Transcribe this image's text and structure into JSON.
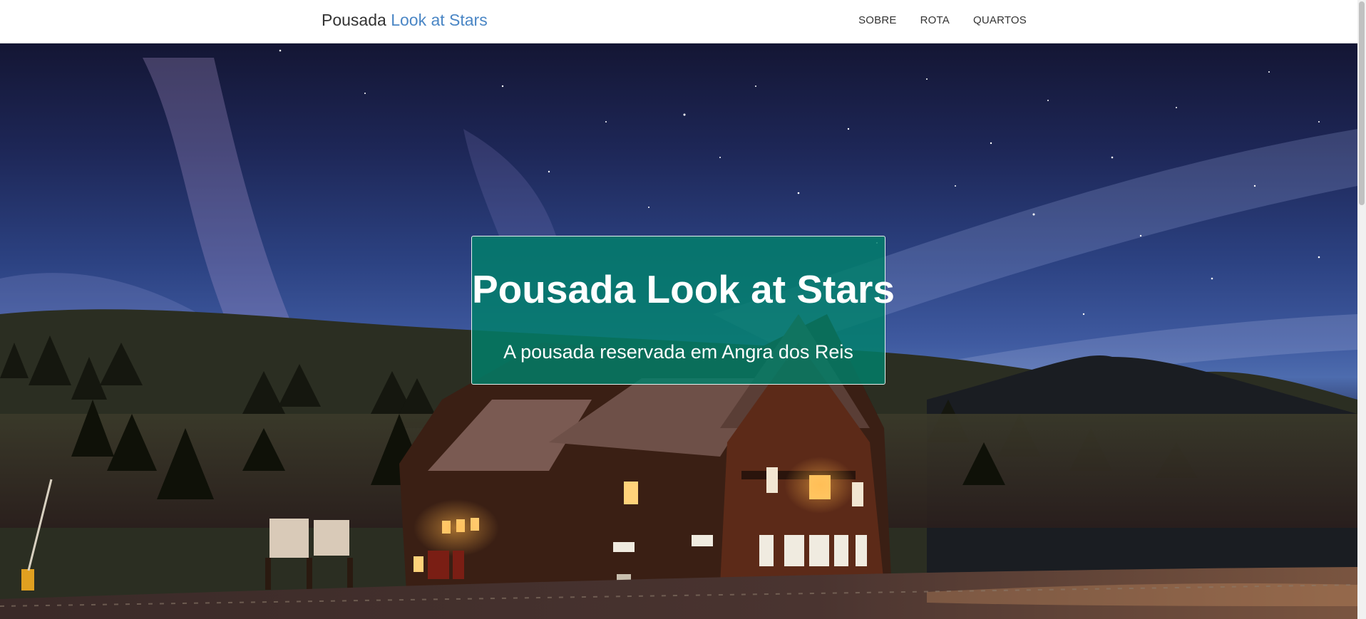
{
  "navbar": {
    "brand_prefix": "Pousada",
    "brand_accent": "Look at Stars",
    "links": [
      {
        "label": "SOBRE"
      },
      {
        "label": "ROTA"
      },
      {
        "label": "QUARTOS"
      }
    ]
  },
  "hero": {
    "title": "Pousada Look at Stars",
    "subtitle": "A pousada reservada em Angra dos Reis",
    "background_image": "night-sky-lodge"
  },
  "colors": {
    "brand_accent": "#4a86c5",
    "hero_box": "#00806a",
    "text_dark": "#333333"
  }
}
